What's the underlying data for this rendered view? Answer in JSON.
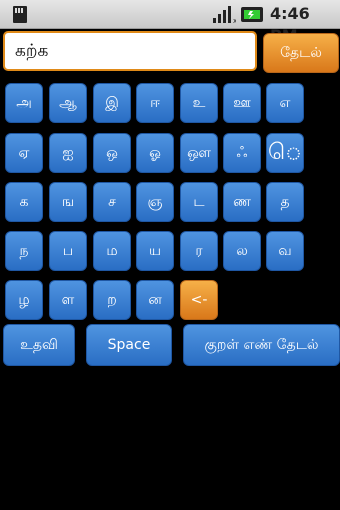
{
  "status_bar": {
    "time": "4:46 PM",
    "icons": [
      "sd-card-icon",
      "signal-icon",
      "battery-icon"
    ]
  },
  "search": {
    "value": "கற்க",
    "button_label": "தேடல்"
  },
  "keyboard": {
    "rows": [
      [
        "அ",
        "ஆ",
        "இ",
        "ஈ",
        "உ",
        "ஊ",
        "எ"
      ],
      [
        "ஏ",
        "ஐ",
        "ஒ",
        "ஓ",
        "ஔ",
        "ஃ",
        "ெ"
      ],
      [
        "க",
        "ங",
        "ச",
        "ஞ",
        "ட",
        "ண",
        "த"
      ],
      [
        "ந",
        "ப",
        "ம",
        "ய",
        "ர",
        "ல",
        "வ"
      ],
      [
        "ழ",
        "ள",
        "ற",
        "ன",
        "<-"
      ]
    ],
    "bottom": {
      "help_label": "உதவி",
      "space_label": "Space",
      "kural_search_label": "குறள் எண் தேடல்"
    }
  },
  "colors": {
    "key_blue": "#3a82d6",
    "accent_orange": "#e8911f",
    "status_bar": "#d8d8d8",
    "background": "#000000"
  }
}
